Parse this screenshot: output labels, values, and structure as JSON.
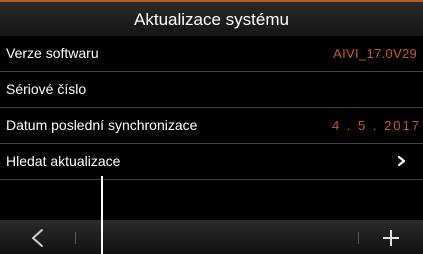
{
  "header": {
    "title": "Aktualizace systému"
  },
  "rows": [
    {
      "label": "Verze softwaru",
      "value": "AIVI_17.0V29"
    },
    {
      "label": "Sériové číslo",
      "value": ""
    },
    {
      "label": "Datum poslední synchronizace",
      "value": "4 . 5 . 2017"
    },
    {
      "label": "Hledat aktualizace",
      "value": ""
    }
  ],
  "icons": {
    "chevron": "chevron-right-icon",
    "back": "back-arrow-icon",
    "plus": "plus-icon"
  },
  "colors": {
    "accent": "#c35a2a",
    "background": "#000000",
    "text": "#ffffff"
  }
}
